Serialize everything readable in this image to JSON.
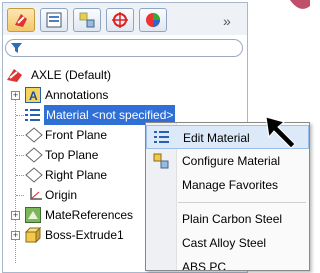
{
  "panel": {
    "overflow_label": "»"
  },
  "tree": {
    "root": "AXLE  (Default)",
    "items": [
      {
        "label": "Annotations"
      },
      {
        "label": "Material <not specified>"
      },
      {
        "label": "Front Plane"
      },
      {
        "label": "Top Plane"
      },
      {
        "label": "Right Plane"
      },
      {
        "label": "Origin"
      },
      {
        "label": "MateReferences"
      },
      {
        "label": "Boss-Extrude1"
      }
    ]
  },
  "context_menu": {
    "items": [
      {
        "label": "Edit Material"
      },
      {
        "label": "Configure Material"
      },
      {
        "label": "Manage Favorites"
      },
      {
        "label": "Plain Carbon Steel"
      },
      {
        "label": "Cast Alloy Steel"
      },
      {
        "label": "ABS PC"
      }
    ]
  },
  "colors": {
    "selection": "#2f6fd6",
    "highlight": "#dce9f9"
  }
}
